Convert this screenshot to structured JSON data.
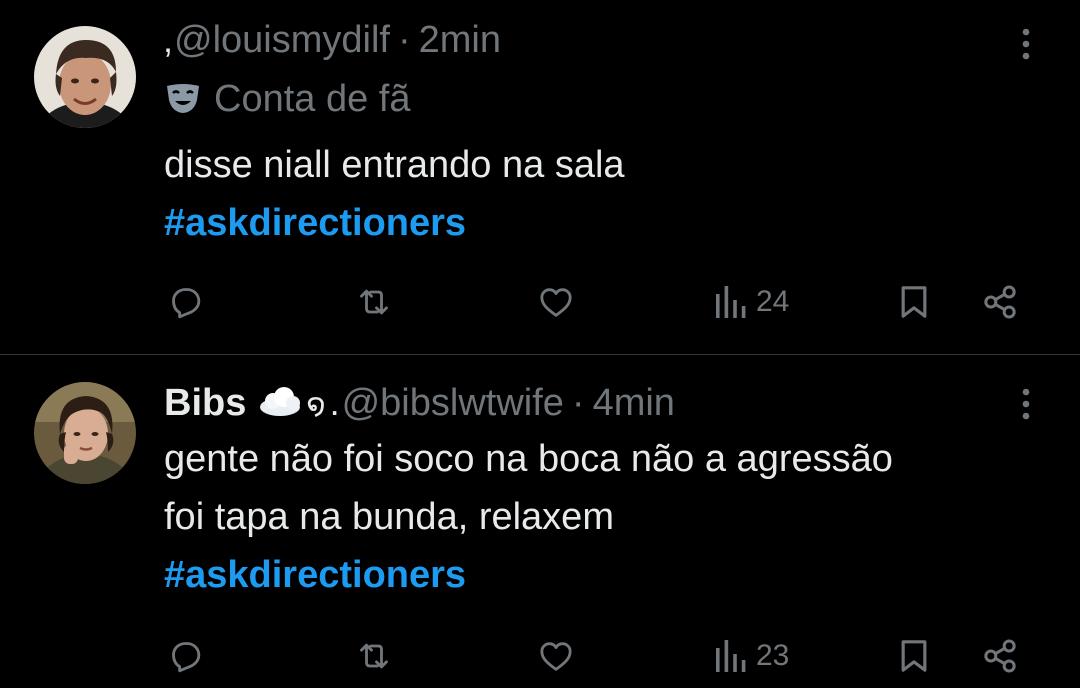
{
  "colors": {
    "background": "#000000",
    "text_primary": "#e7e9ea",
    "text_secondary": "#71767b",
    "hashtag": "#1d9bf0",
    "divider": "#2f3336"
  },
  "tweets": [
    {
      "avatar": "avatar-photo",
      "display_name": "",
      "name_glyph": "‚",
      "handle": "@louismydilf",
      "separator": "·",
      "time": "2min",
      "label_icon": "theater-mask-icon",
      "label": "Conta de fã",
      "text_lines": [
        "disse niall entrando na sala"
      ],
      "hashtag": "#askdirectioners",
      "views": "24",
      "icons": [
        "reply-icon",
        "retweet-icon",
        "like-icon",
        "views-icon",
        "bookmark-icon",
        "share-icon",
        "more-icon"
      ]
    },
    {
      "avatar": "avatar-photo",
      "display_name": "Bibs",
      "name_emoji": "cloud-emoji",
      "name_glyph": "໑",
      "name_tick": ".",
      "handle": "@bibslwtwife",
      "separator": "·",
      "time": "4min",
      "text_lines": [
        "gente não foi soco na boca não a agressão",
        "foi tapa na bunda, relaxem"
      ],
      "hashtag": "#askdirectioners",
      "views": "23",
      "icons": [
        "reply-icon",
        "retweet-icon",
        "like-icon",
        "views-icon",
        "bookmark-icon",
        "share-icon",
        "more-icon"
      ]
    }
  ]
}
